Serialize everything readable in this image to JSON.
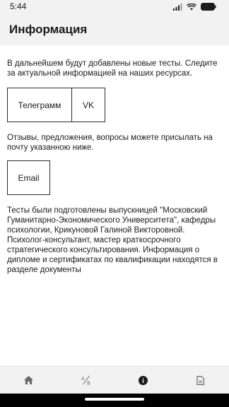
{
  "status_bar": {
    "time": "5:44",
    "icons": [
      "signal-icon",
      "wifi-icon",
      "battery-icon"
    ]
  },
  "header": {
    "title": "Информация"
  },
  "content": {
    "intro_text": "В дальнейшем будут добавлены новые тесты. Следите за актуальной информацией на наших ресурсах.",
    "telegram_button": "Телеграмм",
    "vk_button": "VK",
    "feedback_text": "Отзывы, предложения, вопросы можете  присылать на почту указанною ниже.",
    "email_button": "Email",
    "about_text": "Тесты были подготовлены  выпускницей \"Московский Гуманитарно-Экономического Университета\", кафедры психологии, Крикуновой Галиной Викторовной. Психолог-консультант, мастер краткосрочного стратегического консультирования. Информация  о дипломе и сертификатах по квалификации находятся в разделе документы"
  },
  "bottom_nav": {
    "items": [
      {
        "icon": "home-icon",
        "active": false
      },
      {
        "icon": "ab-test-icon",
        "active": false
      },
      {
        "icon": "info-icon",
        "active": true
      },
      {
        "icon": "document-icon",
        "active": false
      }
    ]
  },
  "colors": {
    "bar_background": "#f2f2f2",
    "content_background": "#ffffff",
    "text": "#1b1b1b",
    "inactive_icon": "#6b6b6b",
    "active_icon": "#1b1b1b"
  }
}
